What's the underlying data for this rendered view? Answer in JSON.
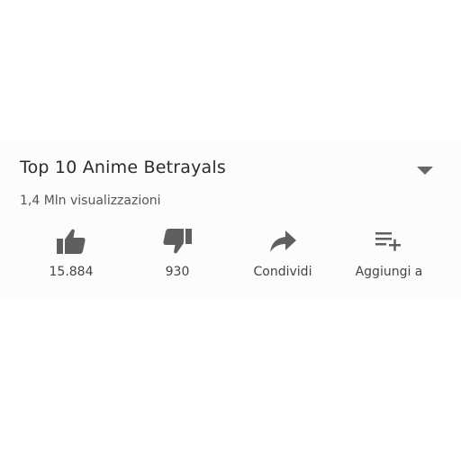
{
  "video": {
    "title": "Top 10 Anime Betrayals",
    "views": "1,4 Mln visualizzazioni"
  },
  "actions": [
    {
      "icon": "thumbs-up-icon",
      "label": "15.884"
    },
    {
      "icon": "thumbs-down-icon",
      "label": "930"
    },
    {
      "icon": "share-icon",
      "label": "Condividi"
    },
    {
      "icon": "playlist-add-icon",
      "label": "Aggiungi a"
    }
  ],
  "colors": {
    "icon": "#5f5f5f",
    "text": "#333333",
    "panel": "#fcfcfc"
  }
}
